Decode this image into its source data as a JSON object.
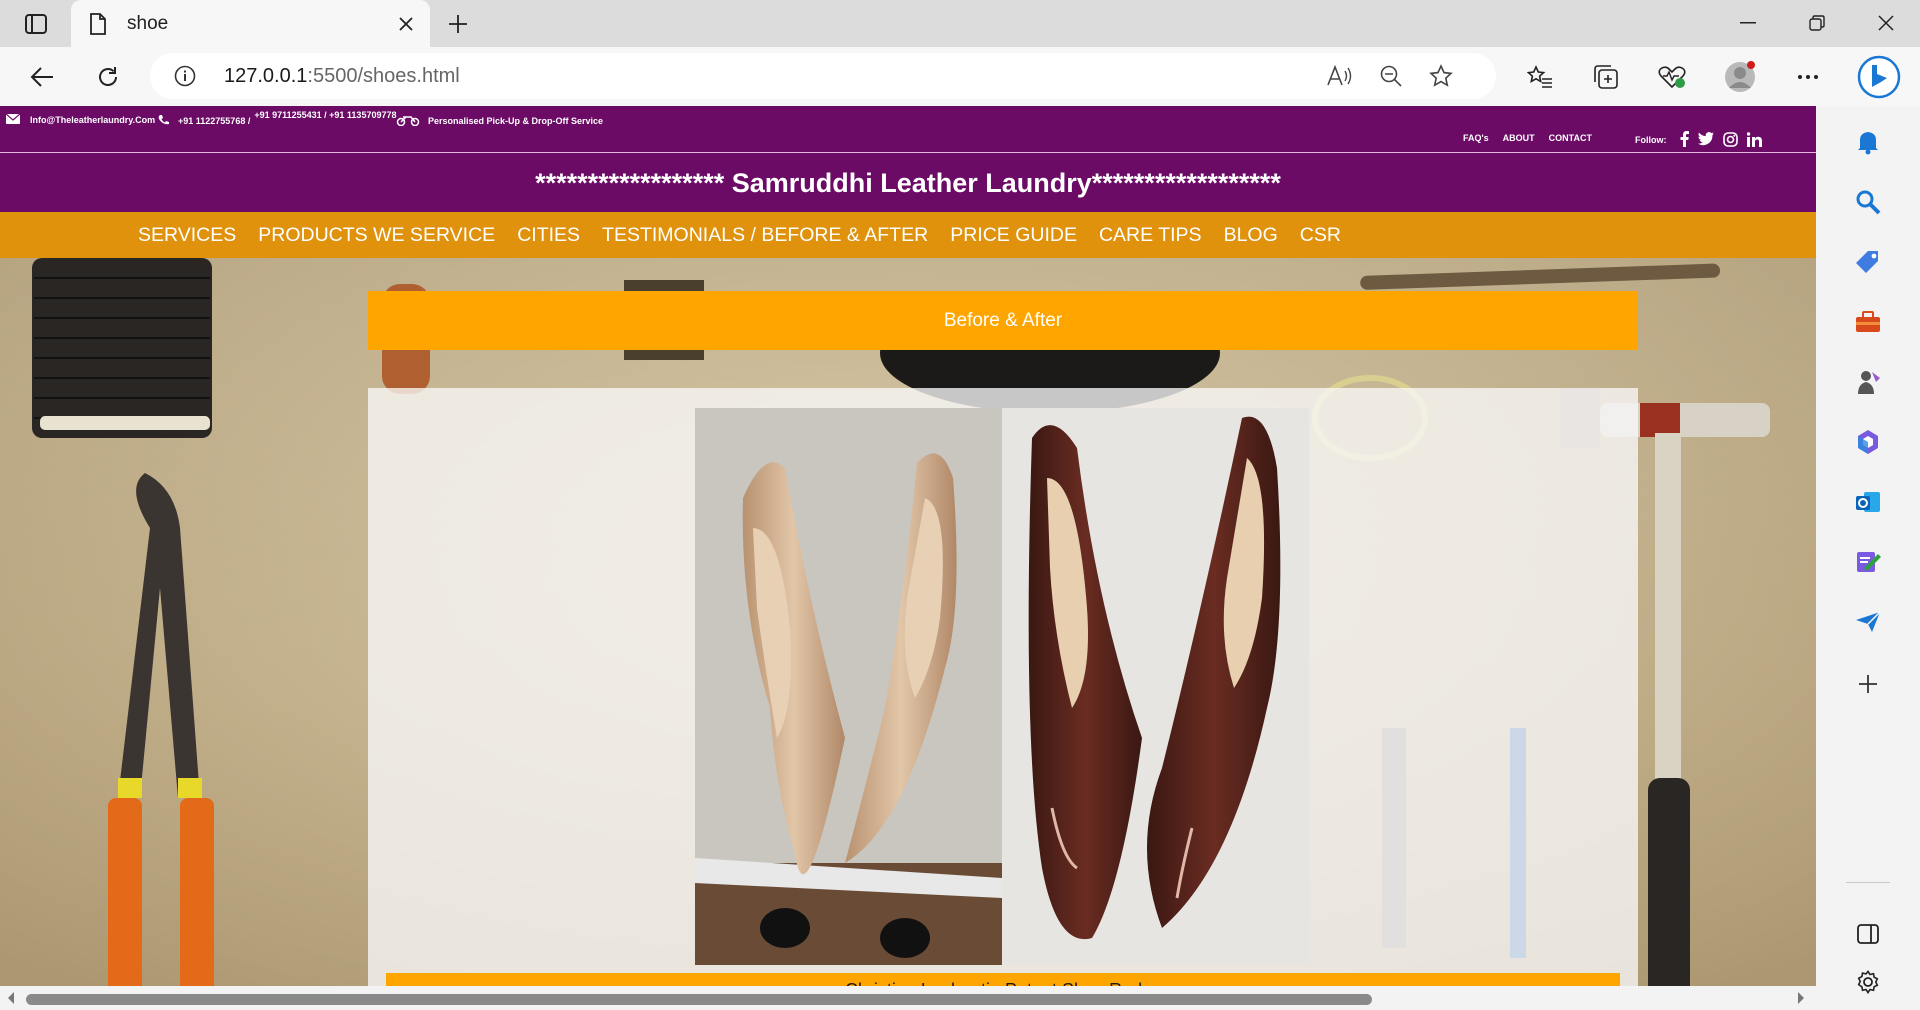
{
  "browser": {
    "tab_title": "shoe",
    "url_host": "127.0.0.1",
    "url_rest": ":5500/shoes.html"
  },
  "site": {
    "email": "Info@Theleatherlaundry.Com",
    "phone1": "+91 1122755768 /",
    "phone2": "+91 9711255431 / +91 1135709778",
    "pickup": "Personalised Pick-Up & Drop-Off Service",
    "top_links": [
      "FAQ's",
      "ABOUT",
      "CONTACT"
    ],
    "follow_label": "Follow:",
    "title": "****************** Samruddhi Leather Laundry******************",
    "nav": [
      "SERVICES",
      "PRODUCTS WE SERVICE",
      "CITIES",
      "TESTIMONIALS / BEFORE & AFTER",
      "PRICE GUIDE",
      "CARE TIPS",
      "BLOG",
      "CSR"
    ],
    "section_title": "Before & After",
    "caption": "Christian Louboutin Patent Shoe Redye"
  },
  "colors": {
    "topbar": "#6b0b66",
    "navbar": "#e0920c",
    "section": "#ffa500"
  },
  "icons": {
    "social": [
      "facebook-icon",
      "twitter-icon",
      "instagram-icon",
      "linkedin-icon"
    ]
  }
}
